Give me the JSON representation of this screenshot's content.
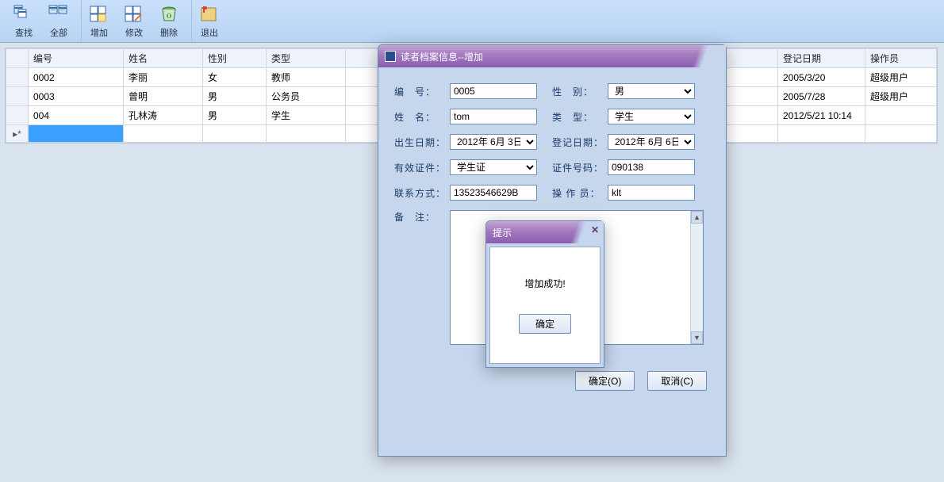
{
  "toolbar": {
    "find": "查找",
    "all": "全部",
    "add": "增加",
    "edit": "修改",
    "delete": "删除",
    "exit": "退出"
  },
  "table": {
    "headers": {
      "id": "编号",
      "name": "姓名",
      "gender": "性别",
      "type": "类型",
      "regdate": "登记日期",
      "operator": "操作员"
    },
    "rows": [
      {
        "id": "0002",
        "name": "李丽",
        "gender": "女",
        "type": "教师",
        "regdate": "2005/3/20",
        "operator": "超级用户"
      },
      {
        "id": "0003",
        "name": "曾明",
        "gender": "男",
        "type": "公务员",
        "regdate": "2005/7/28",
        "operator": "超级用户"
      },
      {
        "id": "004",
        "name": "孔林涛",
        "gender": "男",
        "type": "学生",
        "regdate": "2012/5/21 10:14",
        "operator": ""
      }
    ]
  },
  "dialog": {
    "title": "读者档案信息--增加",
    "labels": {
      "id": "编　号：",
      "gender": "性　别：",
      "name": "姓　名：",
      "type": "类　型：",
      "birth": "出生日期：",
      "regdate": "登记日期：",
      "idtype": "有效证件：",
      "idno": "证件号码：",
      "contact": "联系方式：",
      "operator": "操 作 员：",
      "remark": "备　注："
    },
    "values": {
      "id": "0005",
      "gender": "男",
      "name": "tom",
      "type": "学生",
      "birth": "2012年 6月 3日",
      "regdate": "2012年 6月 6日",
      "idtype": "学生证",
      "idno": "090138",
      "contact": "13523546629B",
      "operator": "klt",
      "remark": ""
    },
    "buttons": {
      "ok": "确定(O)",
      "cancel": "取消(C)"
    }
  },
  "msgbox": {
    "title": "提示",
    "text": "增加成功!",
    "ok": "确定"
  }
}
